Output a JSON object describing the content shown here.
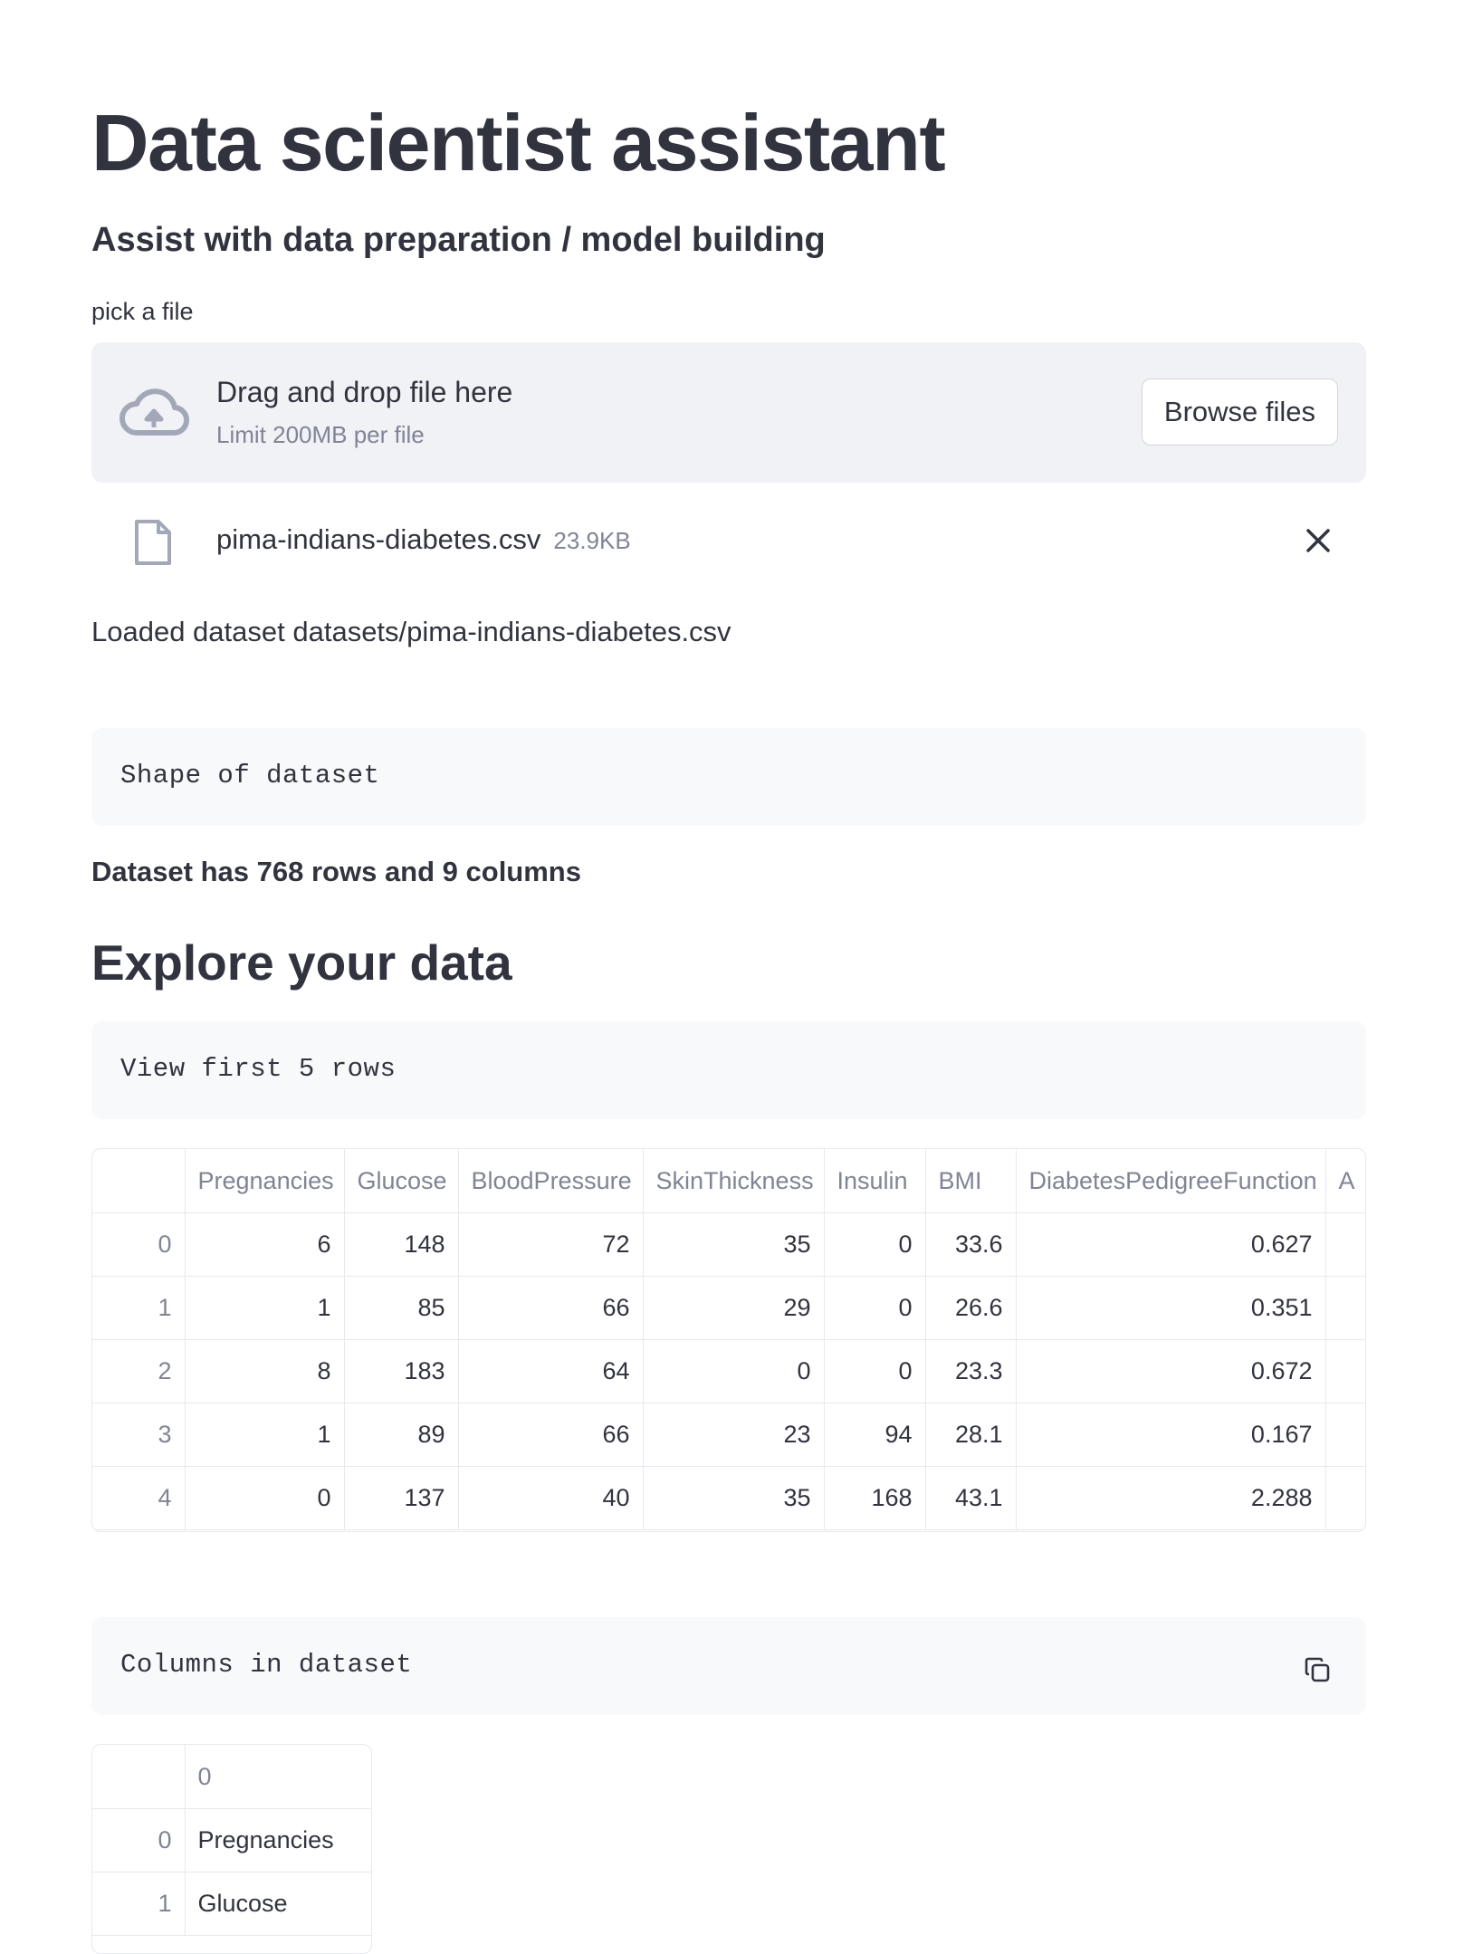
{
  "page": {
    "title": "Data scientist assistant",
    "subtitle": "Assist with data preparation / model building"
  },
  "uploader": {
    "label": "pick a file",
    "drop_text": "Drag and drop file here",
    "limit_text": "Limit 200MB per file",
    "browse_label": "Browse files",
    "file_name": "pima-indians-diabetes.csv",
    "file_size": "23.9KB"
  },
  "loaded_text": "Loaded dataset datasets/pima-indians-diabetes.csv",
  "shape_code": "Shape of dataset",
  "shape_text": "Dataset has 768 rows and 9 columns",
  "explore_heading": "Explore your data",
  "first_rows_code": "View first 5 rows",
  "preview_table": {
    "columns": [
      "Pregnancies",
      "Glucose",
      "BloodPressure",
      "SkinThickness",
      "Insulin",
      "BMI",
      "DiabetesPedigreeFunction",
      "A"
    ],
    "rows": [
      {
        "index": "0",
        "values": [
          "6",
          "148",
          "72",
          "35",
          "0",
          "33.6",
          "0.627",
          ""
        ]
      },
      {
        "index": "1",
        "values": [
          "1",
          "85",
          "66",
          "29",
          "0",
          "26.6",
          "0.351",
          ""
        ]
      },
      {
        "index": "2",
        "values": [
          "8",
          "183",
          "64",
          "0",
          "0",
          "23.3",
          "0.672",
          ""
        ]
      },
      {
        "index": "3",
        "values": [
          "1",
          "89",
          "66",
          "23",
          "94",
          "28.1",
          "0.167",
          ""
        ]
      },
      {
        "index": "4",
        "values": [
          "0",
          "137",
          "40",
          "35",
          "168",
          "43.1",
          "2.288",
          ""
        ]
      }
    ]
  },
  "columns_code": "Columns in dataset",
  "columns_table": {
    "header": "0",
    "rows": [
      {
        "index": "0",
        "value": "Pregnancies"
      },
      {
        "index": "1",
        "value": "Glucose"
      }
    ]
  },
  "icons": {
    "upload": "cloud-upload-icon",
    "file": "file-icon",
    "close": "close-icon",
    "copy": "copy-icon"
  },
  "colors": {
    "text": "#31333f",
    "muted": "#808495",
    "dropzone_bg": "#f0f2f6",
    "code_bg": "#f8f9fb",
    "icon": "#a3a8b8"
  }
}
